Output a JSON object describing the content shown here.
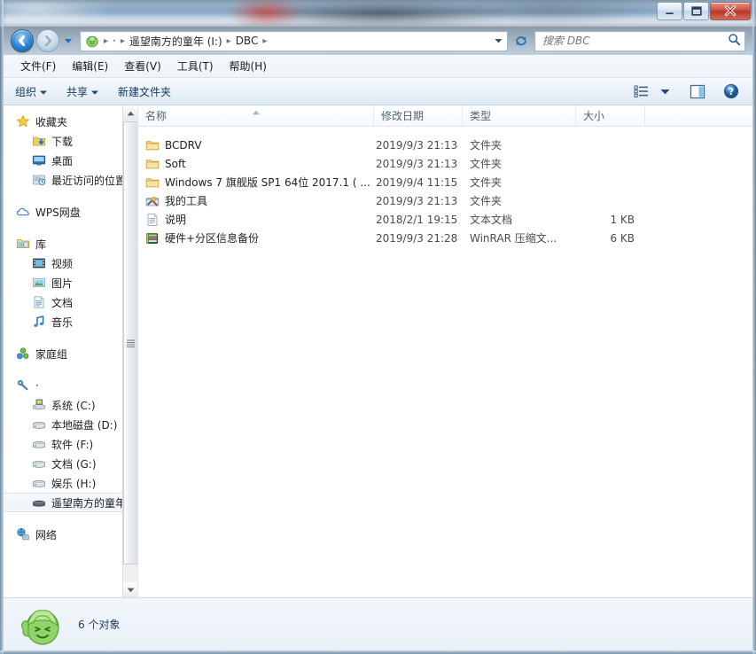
{
  "window": {
    "title": "",
    "controls": {
      "minimize": "最小化",
      "maximize": "最大化",
      "close": "关闭"
    }
  },
  "navbar": {
    "back_label": "后退",
    "forward_label": "前进",
    "recent_pages_label": "最近浏览的页面",
    "breadcrumbs": [
      {
        "label": "",
        "icon": "cabbage-icon"
      },
      {
        "label": "·",
        "icon": ""
      },
      {
        "label": "遥望南方的童年 (I:)",
        "icon": ""
      },
      {
        "label": "DBC",
        "icon": ""
      }
    ],
    "separator": "▸",
    "dropdown_label": "▼",
    "refresh_label": "刷新",
    "search": {
      "placeholder": "搜索 DBC",
      "value": "",
      "icon": "search-icon"
    }
  },
  "menubar": {
    "items": [
      {
        "label": "文件(F)"
      },
      {
        "label": "编辑(E)"
      },
      {
        "label": "查看(V)"
      },
      {
        "label": "工具(T)"
      },
      {
        "label": "帮助(H)"
      }
    ]
  },
  "toolbar": {
    "organize_label": "组织",
    "share_label": "共享",
    "new_folder_label": "新建文件夹",
    "caret": "▼",
    "view_icon": "list-view-icon",
    "view_dropdown_icon": "chevron-down-icon",
    "preview_pane_icon": "preview-pane-icon",
    "help_icon": "help-icon"
  },
  "navpane": {
    "groups": [
      {
        "header": {
          "label": "收藏夹",
          "icon": "star-icon"
        },
        "items": [
          {
            "label": "下载",
            "icon": "downloads-icon"
          },
          {
            "label": "桌面",
            "icon": "desktop-icon"
          },
          {
            "label": "最近访问的位置",
            "icon": "recent-places-icon"
          }
        ]
      },
      {
        "header": {
          "label": "WPS网盘",
          "icon": "cloud-icon"
        },
        "items": []
      },
      {
        "header": {
          "label": "库",
          "icon": "library-icon"
        },
        "items": [
          {
            "label": "视频",
            "icon": "videos-icon"
          },
          {
            "label": "图片",
            "icon": "pictures-icon"
          },
          {
            "label": "文档",
            "icon": "documents-icon"
          },
          {
            "label": "音乐",
            "icon": "music-icon"
          }
        ]
      },
      {
        "header": {
          "label": "家庭组",
          "icon": "homegroup-icon"
        },
        "items": []
      },
      {
        "header": {
          "label": "·",
          "icon": "computer-pin-icon"
        },
        "items": [
          {
            "label": "系统 (C:)",
            "icon": "system-drive-icon",
            "selected": false
          },
          {
            "label": "本地磁盘 (D:)",
            "icon": "drive-icon",
            "selected": false
          },
          {
            "label": "软件 (F:)",
            "icon": "drive-icon",
            "selected": false
          },
          {
            "label": "文档 (G:)",
            "icon": "drive-icon",
            "selected": false
          },
          {
            "label": "娱乐 (H:)",
            "icon": "drive-icon",
            "selected": false
          },
          {
            "label": "遥望南方的童年",
            "icon": "removable-drive-icon",
            "selected": true
          }
        ]
      },
      {
        "header": {
          "label": "网络",
          "icon": "network-icon"
        },
        "items": []
      }
    ],
    "scrollbar": {
      "up_arrow": "▲",
      "down_arrow": "▼"
    }
  },
  "filelist": {
    "columns": [
      {
        "key": "name",
        "label": "名称",
        "sorted": "asc"
      },
      {
        "key": "date",
        "label": "修改日期",
        "sorted": ""
      },
      {
        "key": "type",
        "label": "类型",
        "sorted": ""
      },
      {
        "key": "size",
        "label": "大小",
        "sorted": ""
      }
    ],
    "rows": [
      {
        "name": "BCDRV",
        "date": "2019/9/3 21:13",
        "type": "文件夹",
        "size": "",
        "icon": "folder-icon"
      },
      {
        "name": "Soft",
        "date": "2019/9/3 21:13",
        "type": "文件夹",
        "size": "",
        "icon": "folder-icon"
      },
      {
        "name": "Windows 7 旗舰版 SP1 64位 2017.1 ( ...",
        "date": "2019/9/4 11:15",
        "type": "文件夹",
        "size": "",
        "icon": "folder-icon"
      },
      {
        "name": "我的工具",
        "date": "2019/9/3 21:13",
        "type": "文件夹",
        "size": "",
        "icon": "tools-folder-icon"
      },
      {
        "name": "说明",
        "date": "2018/2/1 19:15",
        "type": "文本文档",
        "size": "1 KB",
        "icon": "text-file-icon"
      },
      {
        "name": "硬件+分区信息备份",
        "date": "2019/9/3 21:28",
        "type": "WinRAR 压缩文...",
        "size": "6 KB",
        "icon": "winrar-icon"
      }
    ]
  },
  "statusbar": {
    "item_count_text": "6 个对象",
    "mascot_icon": "cabbage-mascot-icon"
  },
  "colors": {
    "accent_blue": "#2e86d6",
    "folder_yellow": "#f3c34a",
    "close_red": "#cf4f42",
    "header_text": "#4d6577",
    "selection": "#eef3f8"
  }
}
